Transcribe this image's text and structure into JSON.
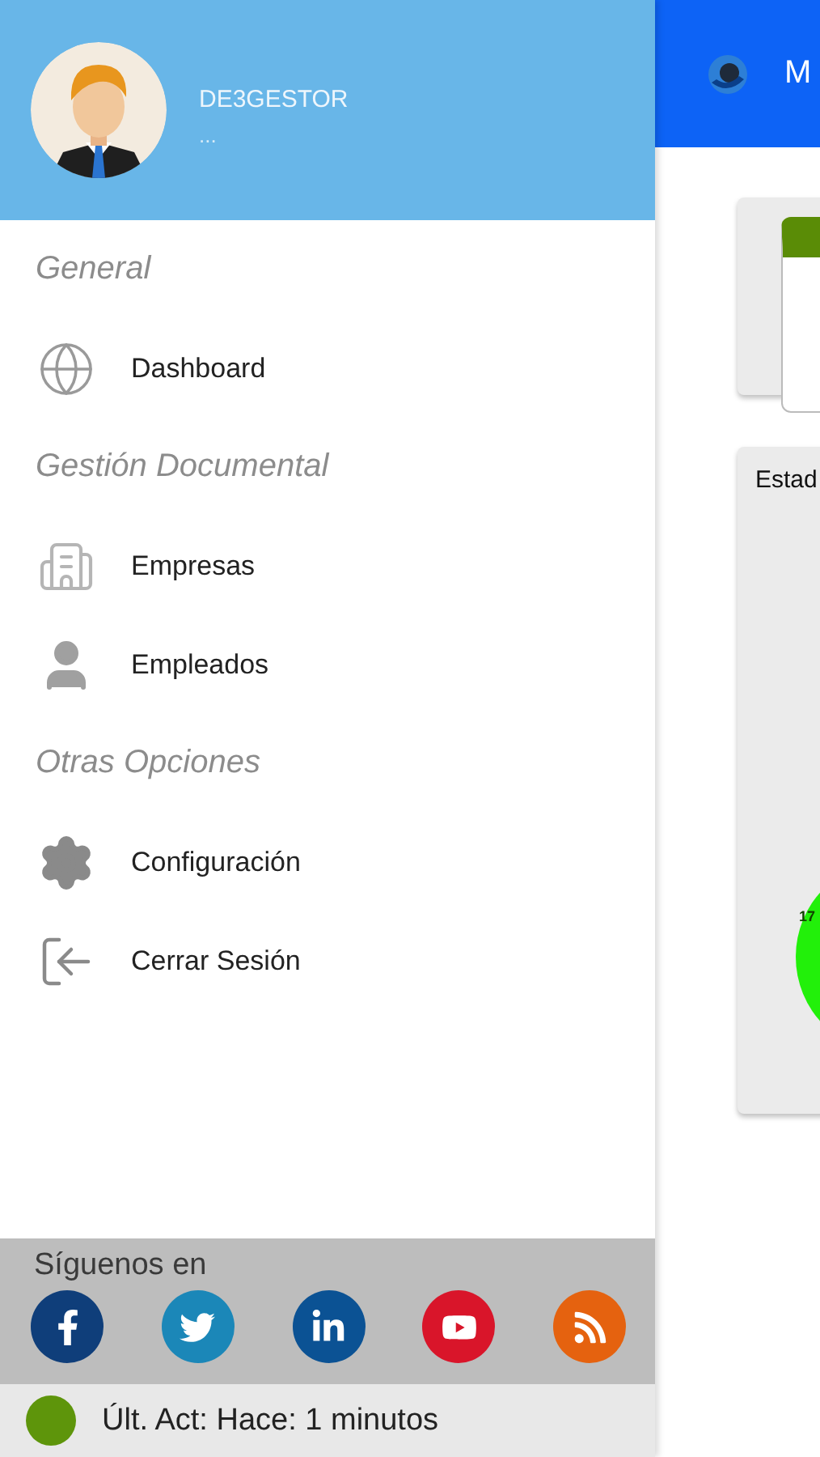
{
  "user": {
    "name": "DE3GESTOR",
    "subtitle": "..."
  },
  "menu": [
    {
      "title": "General",
      "items": [
        {
          "label": "Dashboard"
        }
      ]
    },
    {
      "title": "Gestión Documental",
      "items": [
        {
          "label": "Empresas"
        },
        {
          "label": "Empleados"
        }
      ]
    },
    {
      "title": "Otras Opciones",
      "items": [
        {
          "label": "Configuración"
        },
        {
          "label": "Cerrar Sesión"
        }
      ]
    }
  ],
  "social": {
    "title": "Síguenos en"
  },
  "status": {
    "text": "Últ. Act: Hace: 1 minutos"
  },
  "main": {
    "app_title": "M",
    "chart_card": {
      "title": "Estad",
      "label": "17"
    }
  }
}
